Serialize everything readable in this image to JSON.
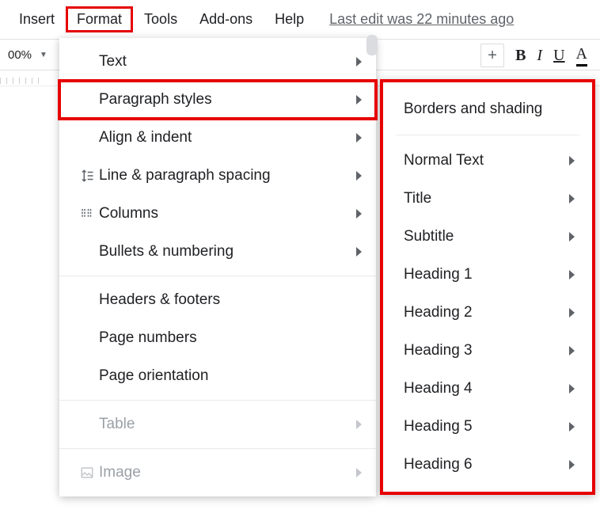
{
  "menubar": {
    "insert": "Insert",
    "format": "Format",
    "tools": "Tools",
    "addons": "Add-ons",
    "help": "Help"
  },
  "last_edit": "Last edit was 22 minutes ago",
  "toolbar": {
    "zoom": "00%",
    "plus": "+",
    "bold": "B",
    "italic": "I",
    "underline": "U",
    "textcolor": "A"
  },
  "format_menu": {
    "text": "Text",
    "paragraph_styles": "Paragraph styles",
    "align_indent": "Align & indent",
    "line_spacing": "Line & paragraph spacing",
    "columns": "Columns",
    "bullets_numbering": "Bullets & numbering",
    "headers_footers": "Headers & footers",
    "page_numbers": "Page numbers",
    "page_orientation": "Page orientation",
    "table": "Table",
    "image": "Image"
  },
  "paragraph_styles_submenu": {
    "borders_shading": "Borders and shading",
    "normal_text": "Normal Text",
    "title": "Title",
    "subtitle": "Subtitle",
    "heading1": "Heading 1",
    "heading2": "Heading 2",
    "heading3": "Heading 3",
    "heading4": "Heading 4",
    "heading5": "Heading 5",
    "heading6": "Heading 6"
  },
  "annotations": {
    "highlighted_menu": "Format",
    "highlighted_item": "Paragraph styles",
    "highlight_color": "#e60000"
  }
}
